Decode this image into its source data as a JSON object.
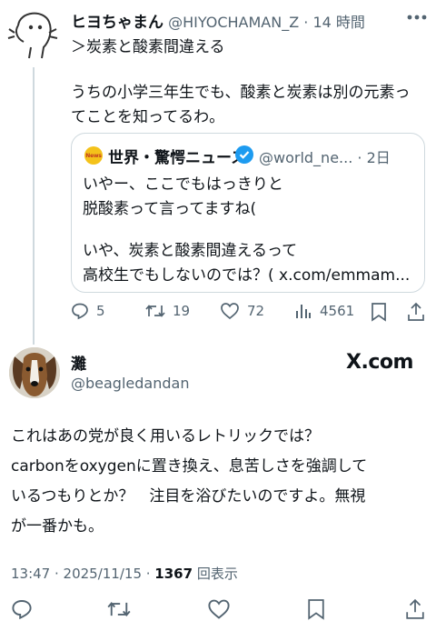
{
  "reply_tweet": {
    "display_name": "ヒヨちゃまん",
    "handle": "@HIYOCHAMAN_Z",
    "separator": "·",
    "time_ago": "14 時間",
    "line1": "＞炭素と酸素間違える",
    "line2": "うちの小学三年生でも、酸素と炭素は別の元素っ",
    "line3": "てことを知ってるわ。"
  },
  "quoted_tweet": {
    "logo_text": "News",
    "display_name": "世界・驚愕ニュース",
    "handle": "@world_ne...",
    "separator": "·",
    "time_ago": "2日",
    "line1": "いやー、ここでもはっきりと",
    "line2": "脱酸素って言ってますね(",
    "line3": "いや、炭素と酸素間違えるって",
    "line4": "高校生でもしないのでは？( x.com/emmam..."
  },
  "reply_actions": {
    "replies": "5",
    "retweets": "19",
    "likes": "72",
    "views": "4561"
  },
  "main_tweet": {
    "display_name": "灘",
    "handle": "@beagledandan",
    "brand": "X.com",
    "line1": "これはあの党が良く用いるレトリックでは？",
    "line2": "carbonをoxygenに置き換え、息苦しさを強調して",
    "line3": "いるつもりとか？　注目を浴びたいのですよ。無視",
    "line4": "が一番かも。",
    "timestamp": "13:47 · 2025/11/15 · ",
    "view_count": "1367",
    "view_label": " 回表示"
  },
  "colors": {
    "text": "#0f1419",
    "muted": "#536471",
    "border": "#cfd9de",
    "verified": "#1d9bf0"
  },
  "icons": [
    "reply-icon",
    "retweet-icon",
    "like-icon",
    "views-icon",
    "bookmark-icon",
    "share-icon",
    "more-icon",
    "verified-icon"
  ]
}
